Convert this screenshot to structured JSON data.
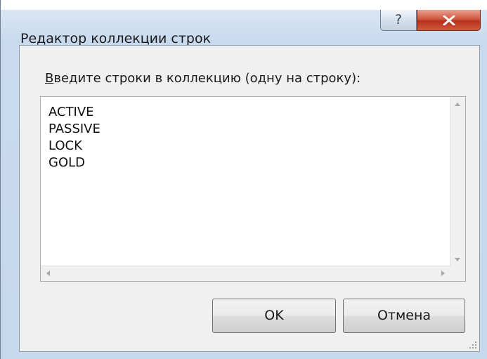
{
  "window": {
    "title": "Редактор коллекции строк",
    "help_label": "?",
    "close_icon": "close-x-icon",
    "accent_colors": {
      "close_button": "#c8432b",
      "frame": "#c6d8ec"
    }
  },
  "prompt": {
    "access_key": "В",
    "label_rest": "ведите строки в коллекцию (одну на строку):"
  },
  "editor": {
    "lines": [
      "ACTIVE",
      "PASSIVE",
      "LOCK",
      "GOLD"
    ]
  },
  "buttons": {
    "ok_label": "OK",
    "cancel_label": "Отмена"
  }
}
